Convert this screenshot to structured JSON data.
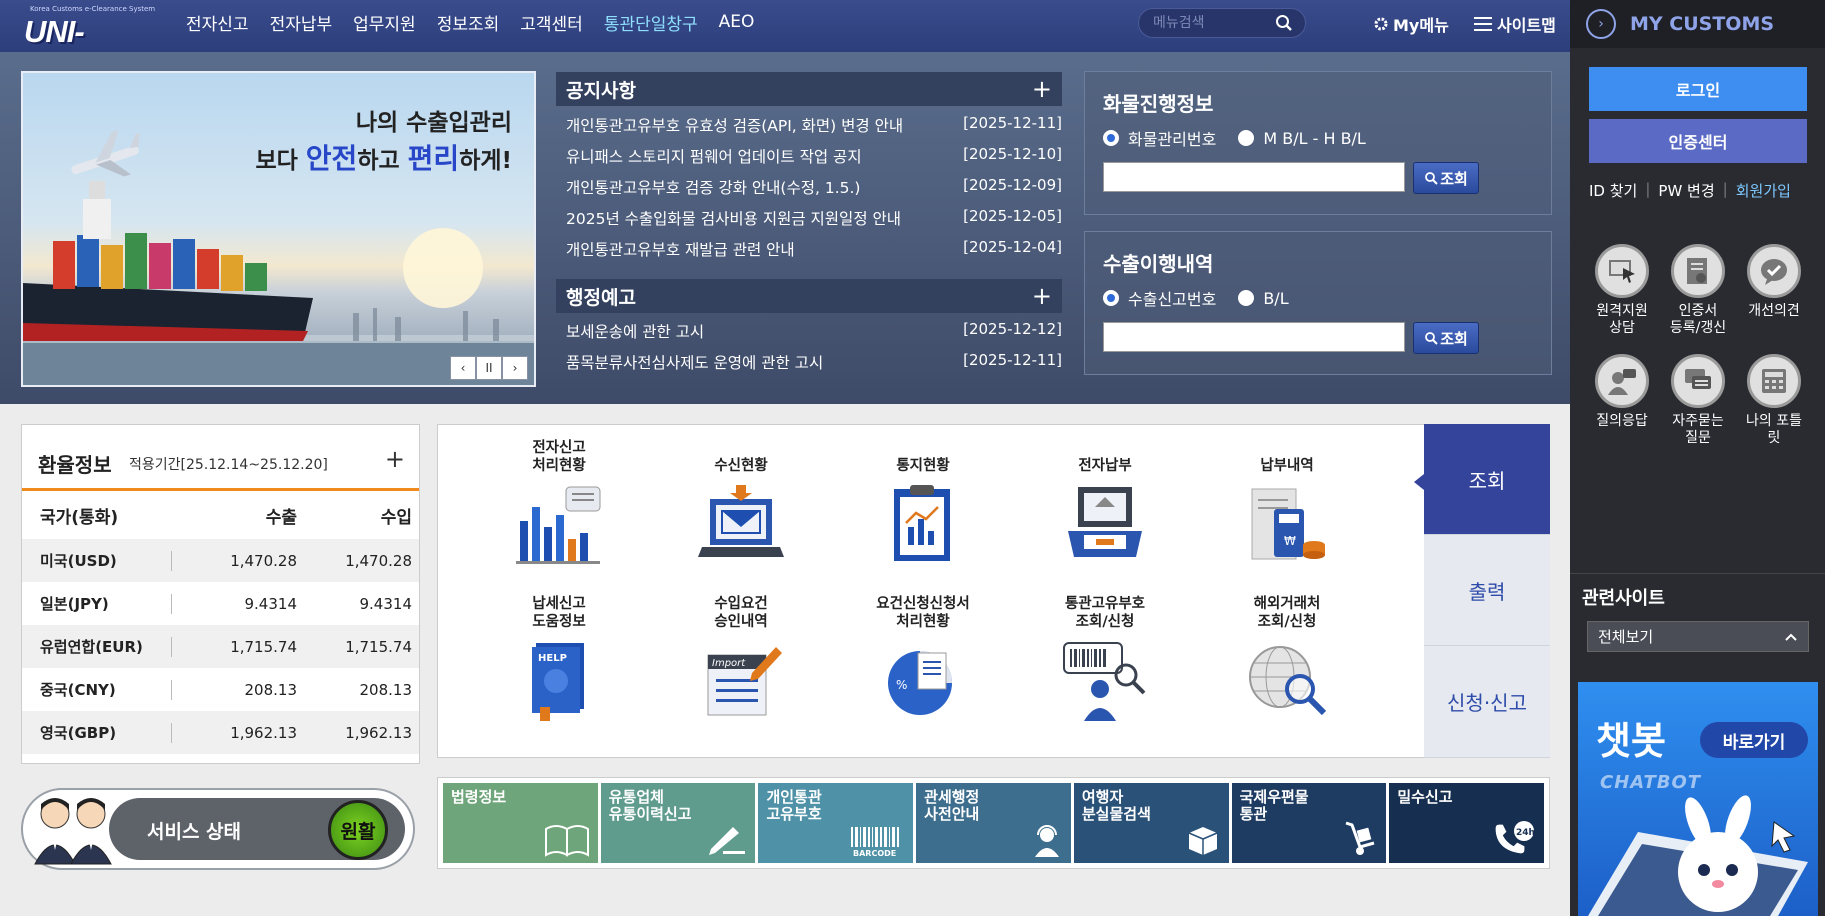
{
  "header": {
    "logo_tagline": "Korea Customs e-Clearance System",
    "logo_text": "UNI-PASS",
    "nav": [
      "전자신고",
      "전자납부",
      "업무지원",
      "정보조회",
      "고객센터",
      "통관단일창구",
      "AEO"
    ],
    "search_placeholder": "메뉴검색",
    "my_menu": "My메뉴",
    "sitemap": "사이트맵"
  },
  "banner": {
    "line1": "나의 수출입관리",
    "line2_a": "보다 ",
    "line2_b": "안전",
    "line2_c": "하고 ",
    "line2_d": "편리",
    "line2_e": "하게!",
    "controls": [
      "‹",
      "II",
      "›"
    ]
  },
  "notices": {
    "title": "공지사항",
    "more": "+",
    "items": [
      {
        "text": "개인통관고유부호 유효성 검증(API, 화면) 변경 안내",
        "date": "[2025-12-11]"
      },
      {
        "text": "유니패스 스토리지 펌웨어 업데이트 작업 공지",
        "date": "[2025-12-10]"
      },
      {
        "text": "개인통관고유부호 검증 강화 안내(수정, 1.5.)",
        "date": "[2025-12-09]"
      },
      {
        "text": "2025년 수출입화물 검사비용 지원금 지원일정 안내",
        "date": "[2025-12-05]"
      },
      {
        "text": "개인통관고유부호 재발급 관련 안내",
        "date": "[2025-12-04]"
      }
    ]
  },
  "admin": {
    "title": "행정예고",
    "more": "+",
    "items": [
      {
        "text": "보세운송에 관한 고시",
        "date": "[2025-12-12]"
      },
      {
        "text": "품목분류사전심사제도 운영에 관한 고시",
        "date": "[2025-12-11]"
      }
    ]
  },
  "cargo": {
    "title": "화물진행정보",
    "option1": "화물관리번호",
    "option2": "M B/L - H B/L",
    "button": "조회"
  },
  "export": {
    "title": "수출이행내역",
    "option1": "수출신고번호",
    "option2": "B/L",
    "button": "조회"
  },
  "fx": {
    "title": "환율정보",
    "period": "적용기간[25.12.14~25.12.20]",
    "more": "+",
    "headers": [
      "국가(통화)",
      "수출",
      "수입"
    ],
    "rows": [
      [
        "미국(USD)",
        "1,470.28",
        "1,470.28"
      ],
      [
        "일본(JPY)",
        "9.4314",
        "9.4314"
      ],
      [
        "유럽연합(EUR)",
        "1,715.74",
        "1,715.74"
      ],
      [
        "중국(CNY)",
        "208.13",
        "208.13"
      ],
      [
        "영국(GBP)",
        "1,962.13",
        "1,962.13"
      ]
    ]
  },
  "services": {
    "row1": [
      "전자신고\n처리현황",
      "수신현황",
      "통지현황",
      "전자납부",
      "납부내역"
    ],
    "row2": [
      "납세신고\n도움정보",
      "수입요건\n승인내역",
      "요건신청신청서\n처리현황",
      "통관고유부호\n조회/신청",
      "해외거래처\n조회/신청"
    ],
    "tabs": [
      "조회",
      "출력",
      "신청·신고"
    ]
  },
  "status": {
    "label": "서비스 상태",
    "value": "원활"
  },
  "links": [
    {
      "label": "법령정보",
      "color": "#6fa57a"
    },
    {
      "label": "유통업체\n유통이력신고",
      "color": "#5f9c8e"
    },
    {
      "label": "개인통관\n고유부호",
      "color": "#4f91a6"
    },
    {
      "label": "관세행정\n사전안내",
      "color": "#3d6e8e"
    },
    {
      "label": "여행자\n분실물검색",
      "color": "#2a5279"
    },
    {
      "label": "국제우편물\n통관",
      "color": "#1e3c62"
    },
    {
      "label": "밀수신고",
      "color": "#162e50"
    }
  ],
  "sidebar": {
    "title": "MY CUSTOMS",
    "login": "로그인",
    "cert": "인증센터",
    "find_id": "ID 찾기",
    "pw_change": "PW 변경",
    "join": "회원가입",
    "icons": [
      "원격지원\n상담",
      "인증서\n등록/갱신",
      "개선의견",
      "질의응답",
      "자주묻는\n질문",
      "나의 포틀\n릿"
    ],
    "related": "관련사이트",
    "related_select": "전체보기",
    "chatbot_title": "챗봇",
    "chatbot_go": "바로가기",
    "chatbot_sub": "CHATBOT"
  }
}
